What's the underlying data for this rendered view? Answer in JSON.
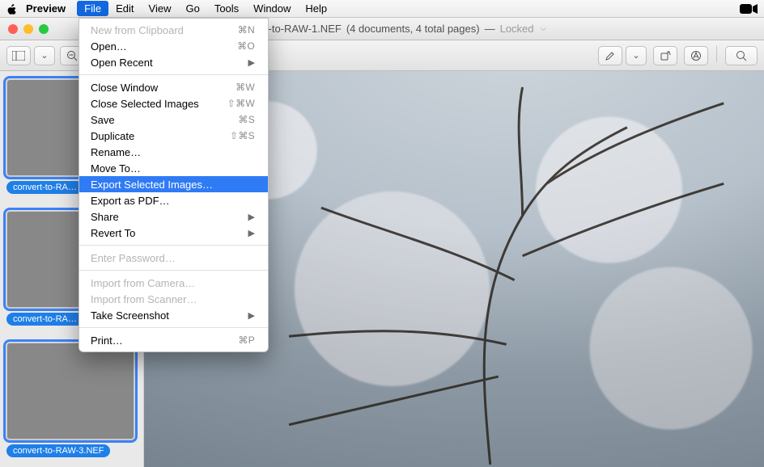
{
  "menubar": {
    "app_name": "Preview",
    "items": [
      "File",
      "Edit",
      "View",
      "Go",
      "Tools",
      "Window",
      "Help"
    ],
    "open_index": 0
  },
  "window": {
    "title_file": "convert-to-RAW-1.NEF",
    "title_info": "(4 documents, 4 total pages)",
    "locked_text": "Locked"
  },
  "toolbar": {
    "icons": {
      "sidebar": "sidebar-icon",
      "zoom_out": "−",
      "zoom_in": "+",
      "share": "share-icon",
      "annotate": "annotate-icon",
      "rotate": "rotate-icon",
      "markup": "markup-icon",
      "search": "search-icon"
    }
  },
  "sidebar": {
    "thumbs": [
      {
        "label": "convert-to-RA…",
        "selected": true
      },
      {
        "label": "convert-to-RA…",
        "selected": true
      },
      {
        "label": "convert-to-RAW-3.NEF",
        "selected": true
      }
    ]
  },
  "file_menu": {
    "sections": [
      [
        {
          "label": "New from Clipboard",
          "shortcut": "⌘N",
          "disabled": true
        },
        {
          "label": "Open…",
          "shortcut": "⌘O"
        },
        {
          "label": "Open Recent",
          "submenu": true
        }
      ],
      [
        {
          "label": "Close Window",
          "shortcut": "⌘W"
        },
        {
          "label": "Close Selected Images",
          "shortcut": "⇧⌘W"
        },
        {
          "label": "Save",
          "shortcut": "⌘S"
        },
        {
          "label": "Duplicate",
          "shortcut": "⇧⌘S"
        },
        {
          "label": "Rename…"
        },
        {
          "label": "Move To…"
        },
        {
          "label": "Export Selected Images…",
          "highlight": true
        },
        {
          "label": "Export as PDF…"
        },
        {
          "label": "Share",
          "submenu": true
        },
        {
          "label": "Revert To",
          "submenu": true
        }
      ],
      [
        {
          "label": "Enter Password…",
          "disabled": true
        }
      ],
      [
        {
          "label": "Import from Camera…",
          "disabled": true
        },
        {
          "label": "Import from Scanner…",
          "disabled": true
        },
        {
          "label": "Take Screenshot",
          "submenu": true
        }
      ],
      [
        {
          "label": "Print…",
          "shortcut": "⌘P"
        }
      ]
    ]
  }
}
